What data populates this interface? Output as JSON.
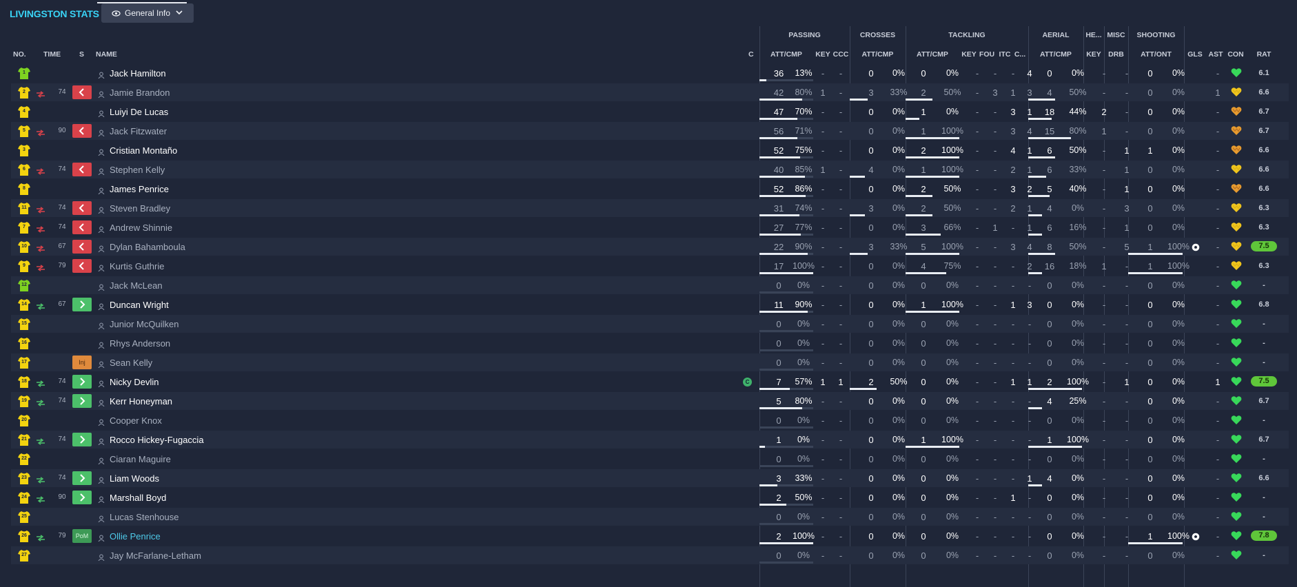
{
  "app": {
    "title": "LIVINGSTON STATS",
    "view_button_label": "General Info",
    "accent_color": "#39d3f5"
  },
  "columns": {
    "no": "NO.",
    "time": "TIME",
    "s": "S",
    "name": "NAME",
    "c": "C",
    "groups": {
      "passing": "PASSING",
      "crosses": "CROSSES",
      "tackling": "TACKLING",
      "aerial": "AERIAL",
      "headers": "HE...",
      "misc": "MISC",
      "shooting": "SHOOTING"
    },
    "sub": {
      "pass_att": "ATT/CMP",
      "pass_key": "KEY",
      "pass_ccc": "CCC",
      "cross_att": "ATT/CMP",
      "tack_att": "ATT/CMP",
      "tack_key": "KEY",
      "tack_fou": "FOU",
      "tack_itc": "ITC",
      "tack_c": "C...",
      "aer_att": "ATT/CMP",
      "head_key": "KEY",
      "misc_drb": "DRB",
      "shoot_att": "ATT/ONT",
      "gls": "GLS",
      "ast": "AST",
      "con": "CON",
      "rat": "RAT"
    }
  },
  "players": [
    {
      "no": "1",
      "time": "",
      "s": "",
      "name": "Jack Hamilton",
      "active": true,
      "pass": [
        "36",
        "13%"
      ],
      "pkey": "-",
      "pccc": "-",
      "cross": [
        "0",
        "0%"
      ],
      "tack": [
        "0",
        "0%"
      ],
      "tkey": "-",
      "tfou": "-",
      "titc": "-",
      "tc": "4",
      "aer": [
        "0",
        "0%"
      ],
      "hkey": "-",
      "drb": "-",
      "shoot": [
        "0",
        "0%"
      ],
      "gls": "",
      "ast": "-",
      "rat": "6.1",
      "ratHi": false
    },
    {
      "no": "2",
      "time": "74",
      "s": "out",
      "name": "Jamie Brandon",
      "active": false,
      "pass": [
        "42",
        "80%"
      ],
      "pkey": "1",
      "pccc": "-",
      "cross": [
        "3",
        "33%"
      ],
      "tack": [
        "2",
        "50%"
      ],
      "tkey": "-",
      "tfou": "3",
      "titc": "1",
      "tc": "3",
      "aer": [
        "4",
        "50%"
      ],
      "hkey": "-",
      "drb": "-",
      "shoot": [
        "0",
        "0%"
      ],
      "gls": "",
      "ast": "1",
      "rat": "6.6",
      "ratHi": false
    },
    {
      "no": "4",
      "time": "",
      "s": "",
      "name": "Luiyi De Lucas",
      "active": true,
      "pass": [
        "47",
        "70%"
      ],
      "pkey": "-",
      "pccc": "-",
      "cross": [
        "0",
        "0%"
      ],
      "tack": [
        "1",
        "0%"
      ],
      "tkey": "-",
      "tfou": "-",
      "titc": "3",
      "tc": "1",
      "aer": [
        "18",
        "44%"
      ],
      "hkey": "2",
      "drb": "-",
      "shoot": [
        "0",
        "0%"
      ],
      "gls": "",
      "ast": "-",
      "rat": "6.7",
      "ratHi": false
    },
    {
      "no": "5",
      "time": "90",
      "s": "out",
      "name": "Jack Fitzwater",
      "active": false,
      "pass": [
        "56",
        "71%"
      ],
      "pkey": "-",
      "pccc": "-",
      "cross": [
        "0",
        "0%"
      ],
      "tack": [
        "1",
        "100%"
      ],
      "tkey": "-",
      "tfou": "-",
      "titc": "3",
      "tc": "4",
      "aer": [
        "15",
        "80%"
      ],
      "hkey": "1",
      "drb": "-",
      "shoot": [
        "0",
        "0%"
      ],
      "gls": "",
      "ast": "-",
      "rat": "6.7",
      "ratHi": false
    },
    {
      "no": "3",
      "time": "",
      "s": "",
      "name": "Cristian Montaño",
      "active": true,
      "pass": [
        "52",
        "75%"
      ],
      "pkey": "-",
      "pccc": "-",
      "cross": [
        "0",
        "0%"
      ],
      "tack": [
        "2",
        "100%"
      ],
      "tkey": "-",
      "tfou": "-",
      "titc": "4",
      "tc": "1",
      "aer": [
        "6",
        "50%"
      ],
      "hkey": "-",
      "drb": "1",
      "shoot": [
        "1",
        "0%"
      ],
      "gls": "",
      "ast": "-",
      "rat": "6.6",
      "ratHi": false
    },
    {
      "no": "6",
      "time": "74",
      "s": "out",
      "name": "Stephen Kelly",
      "active": false,
      "pass": [
        "40",
        "85%"
      ],
      "pkey": "1",
      "pccc": "-",
      "cross": [
        "4",
        "0%"
      ],
      "tack": [
        "1",
        "100%"
      ],
      "tkey": "-",
      "tfou": "-",
      "titc": "2",
      "tc": "1",
      "aer": [
        "6",
        "33%"
      ],
      "hkey": "-",
      "drb": "1",
      "shoot": [
        "0",
        "0%"
      ],
      "gls": "",
      "ast": "-",
      "rat": "6.6",
      "ratHi": false
    },
    {
      "no": "8",
      "time": "",
      "s": "",
      "name": "James Penrice",
      "active": true,
      "pass": [
        "52",
        "86%"
      ],
      "pkey": "-",
      "pccc": "-",
      "cross": [
        "0",
        "0%"
      ],
      "tack": [
        "2",
        "50%"
      ],
      "tkey": "-",
      "tfou": "-",
      "titc": "3",
      "tc": "2",
      "aer": [
        "5",
        "40%"
      ],
      "hkey": "-",
      "drb": "1",
      "shoot": [
        "0",
        "0%"
      ],
      "gls": "",
      "ast": "-",
      "rat": "6.6",
      "ratHi": false
    },
    {
      "no": "11",
      "time": "74",
      "s": "out",
      "name": "Steven Bradley",
      "active": false,
      "pass": [
        "31",
        "74%"
      ],
      "pkey": "-",
      "pccc": "-",
      "cross": [
        "3",
        "0%"
      ],
      "tack": [
        "2",
        "50%"
      ],
      "tkey": "-",
      "tfou": "-",
      "titc": "2",
      "tc": "1",
      "aer": [
        "4",
        "0%"
      ],
      "hkey": "-",
      "drb": "3",
      "shoot": [
        "0",
        "0%"
      ],
      "gls": "",
      "ast": "-",
      "rat": "6.3",
      "ratHi": false
    },
    {
      "no": "7",
      "time": "74",
      "s": "out",
      "name": "Andrew Shinnie",
      "active": false,
      "pass": [
        "27",
        "77%"
      ],
      "pkey": "-",
      "pccc": "-",
      "cross": [
        "0",
        "0%"
      ],
      "tack": [
        "3",
        "66%"
      ],
      "tkey": "-",
      "tfou": "1",
      "titc": "-",
      "tc": "1",
      "aer": [
        "6",
        "16%"
      ],
      "hkey": "-",
      "drb": "1",
      "shoot": [
        "0",
        "0%"
      ],
      "gls": "",
      "ast": "-",
      "rat": "6.3",
      "ratHi": false
    },
    {
      "no": "10",
      "time": "67",
      "s": "out",
      "name": "Dylan Bahamboula",
      "active": false,
      "pass": [
        "22",
        "90%"
      ],
      "pkey": "-",
      "pccc": "-",
      "cross": [
        "3",
        "33%"
      ],
      "tack": [
        "5",
        "100%"
      ],
      "tkey": "-",
      "tfou": "-",
      "titc": "3",
      "tc": "4",
      "aer": [
        "8",
        "50%"
      ],
      "hkey": "-",
      "drb": "5",
      "shoot": [
        "1",
        "100%"
      ],
      "gls": "ball",
      "ast": "-",
      "rat": "7.5",
      "ratHi": true
    },
    {
      "no": "9",
      "time": "79",
      "s": "out",
      "name": "Kurtis Guthrie",
      "active": false,
      "pass": [
        "17",
        "100%"
      ],
      "pkey": "-",
      "pccc": "-",
      "cross": [
        "0",
        "0%"
      ],
      "tack": [
        "4",
        "75%"
      ],
      "tkey": "-",
      "tfou": "-",
      "titc": "-",
      "tc": "2",
      "aer": [
        "16",
        "18%"
      ],
      "hkey": "1",
      "drb": "-",
      "shoot": [
        "1",
        "100%"
      ],
      "gls": "",
      "ast": "-",
      "rat": "6.3",
      "ratHi": false
    },
    {
      "no": "12",
      "time": "",
      "s": "",
      "name": "Jack McLean",
      "active": false,
      "gk": true,
      "pass": [
        "0",
        "0%"
      ],
      "pkey": "-",
      "pccc": "-",
      "cross": [
        "0",
        "0%"
      ],
      "tack": [
        "0",
        "0%"
      ],
      "tkey": "-",
      "tfou": "-",
      "titc": "-",
      "tc": "-",
      "aer": [
        "0",
        "0%"
      ],
      "hkey": "-",
      "drb": "-",
      "shoot": [
        "0",
        "0%"
      ],
      "gls": "",
      "ast": "-",
      "rat": "-",
      "ratHi": false
    },
    {
      "no": "14",
      "time": "67",
      "s": "in",
      "name": "Duncan Wright",
      "active": true,
      "pass": [
        "11",
        "90%"
      ],
      "pkey": "-",
      "pccc": "-",
      "cross": [
        "0",
        "0%"
      ],
      "tack": [
        "1",
        "100%"
      ],
      "tkey": "-",
      "tfou": "-",
      "titc": "1",
      "tc": "3",
      "aer": [
        "0",
        "0%"
      ],
      "hkey": "-",
      "drb": "-",
      "shoot": [
        "0",
        "0%"
      ],
      "gls": "",
      "ast": "-",
      "rat": "6.8",
      "ratHi": false
    },
    {
      "no": "15",
      "time": "",
      "s": "",
      "name": "Junior McQuilken",
      "active": false,
      "pass": [
        "0",
        "0%"
      ],
      "pkey": "-",
      "pccc": "-",
      "cross": [
        "0",
        "0%"
      ],
      "tack": [
        "0",
        "0%"
      ],
      "tkey": "-",
      "tfou": "-",
      "titc": "-",
      "tc": "-",
      "aer": [
        "0",
        "0%"
      ],
      "hkey": "-",
      "drb": "-",
      "shoot": [
        "0",
        "0%"
      ],
      "gls": "",
      "ast": "-",
      "rat": "-",
      "ratHi": false
    },
    {
      "no": "16",
      "time": "",
      "s": "",
      "name": "Rhys Anderson",
      "active": false,
      "pass": [
        "0",
        "0%"
      ],
      "pkey": "-",
      "pccc": "-",
      "cross": [
        "0",
        "0%"
      ],
      "tack": [
        "0",
        "0%"
      ],
      "tkey": "-",
      "tfou": "-",
      "titc": "-",
      "tc": "-",
      "aer": [
        "0",
        "0%"
      ],
      "hkey": "-",
      "drb": "-",
      "shoot": [
        "0",
        "0%"
      ],
      "gls": "",
      "ast": "-",
      "rat": "-",
      "ratHi": false
    },
    {
      "no": "17",
      "time": "",
      "s": "inj",
      "name": "Sean Kelly",
      "active": false,
      "pass": [
        "0",
        "0%"
      ],
      "pkey": "-",
      "pccc": "-",
      "cross": [
        "0",
        "0%"
      ],
      "tack": [
        "0",
        "0%"
      ],
      "tkey": "-",
      "tfou": "-",
      "titc": "-",
      "tc": "-",
      "aer": [
        "0",
        "0%"
      ],
      "hkey": "-",
      "drb": "-",
      "shoot": [
        "0",
        "0%"
      ],
      "gls": "",
      "ast": "-",
      "rat": "-",
      "ratHi": false
    },
    {
      "no": "18",
      "time": "74",
      "s": "in",
      "name": "Nicky Devlin",
      "active": true,
      "captain": true,
      "pass": [
        "7",
        "57%"
      ],
      "pkey": "1",
      "pccc": "1",
      "cross": [
        "2",
        "50%"
      ],
      "tack": [
        "0",
        "0%"
      ],
      "tkey": "-",
      "tfou": "-",
      "titc": "1",
      "tc": "1",
      "aer": [
        "2",
        "100%"
      ],
      "hkey": "-",
      "drb": "1",
      "shoot": [
        "0",
        "0%"
      ],
      "gls": "",
      "ast": "1",
      "rat": "7.5",
      "ratHi": true
    },
    {
      "no": "19",
      "time": "74",
      "s": "in",
      "name": "Kerr Honeyman",
      "active": true,
      "pass": [
        "5",
        "80%"
      ],
      "pkey": "-",
      "pccc": "-",
      "cross": [
        "0",
        "0%"
      ],
      "tack": [
        "0",
        "0%"
      ],
      "tkey": "-",
      "tfou": "-",
      "titc": "-",
      "tc": "-",
      "aer": [
        "4",
        "25%"
      ],
      "hkey": "-",
      "drb": "-",
      "shoot": [
        "0",
        "0%"
      ],
      "gls": "",
      "ast": "-",
      "rat": "6.7",
      "ratHi": false
    },
    {
      "no": "20",
      "time": "",
      "s": "",
      "name": "Cooper Knox",
      "active": false,
      "pass": [
        "0",
        "0%"
      ],
      "pkey": "-",
      "pccc": "-",
      "cross": [
        "0",
        "0%"
      ],
      "tack": [
        "0",
        "0%"
      ],
      "tkey": "-",
      "tfou": "-",
      "titc": "-",
      "tc": "-",
      "aer": [
        "0",
        "0%"
      ],
      "hkey": "-",
      "drb": "-",
      "shoot": [
        "0",
        "0%"
      ],
      "gls": "",
      "ast": "-",
      "rat": "-",
      "ratHi": false
    },
    {
      "no": "21",
      "time": "74",
      "s": "in",
      "name": "Rocco Hickey-Fugaccia",
      "active": true,
      "pass": [
        "1",
        "0%"
      ],
      "pkey": "-",
      "pccc": "-",
      "cross": [
        "0",
        "0%"
      ],
      "tack": [
        "1",
        "100%"
      ],
      "tkey": "-",
      "tfou": "-",
      "titc": "-",
      "tc": "-",
      "aer": [
        "1",
        "100%"
      ],
      "hkey": "-",
      "drb": "-",
      "shoot": [
        "0",
        "0%"
      ],
      "gls": "",
      "ast": "-",
      "rat": "6.7",
      "ratHi": false
    },
    {
      "no": "22",
      "time": "",
      "s": "",
      "name": "Ciaran Maguire",
      "active": false,
      "pass": [
        "0",
        "0%"
      ],
      "pkey": "-",
      "pccc": "-",
      "cross": [
        "0",
        "0%"
      ],
      "tack": [
        "0",
        "0%"
      ],
      "tkey": "-",
      "tfou": "-",
      "titc": "-",
      "tc": "-",
      "aer": [
        "0",
        "0%"
      ],
      "hkey": "-",
      "drb": "-",
      "shoot": [
        "0",
        "0%"
      ],
      "gls": "",
      "ast": "-",
      "rat": "-",
      "ratHi": false
    },
    {
      "no": "23",
      "time": "74",
      "s": "in",
      "name": "Liam Woods",
      "active": true,
      "pass": [
        "3",
        "33%"
      ],
      "pkey": "-",
      "pccc": "-",
      "cross": [
        "0",
        "0%"
      ],
      "tack": [
        "0",
        "0%"
      ],
      "tkey": "-",
      "tfou": "-",
      "titc": "-",
      "tc": "1",
      "aer": [
        "4",
        "0%"
      ],
      "hkey": "-",
      "drb": "-",
      "shoot": [
        "0",
        "0%"
      ],
      "gls": "",
      "ast": "-",
      "rat": "6.6",
      "ratHi": false
    },
    {
      "no": "24",
      "time": "90",
      "s": "in",
      "name": "Marshall Boyd",
      "active": true,
      "pass": [
        "2",
        "50%"
      ],
      "pkey": "-",
      "pccc": "-",
      "cross": [
        "0",
        "0%"
      ],
      "tack": [
        "0",
        "0%"
      ],
      "tkey": "-",
      "tfou": "-",
      "titc": "1",
      "tc": "-",
      "aer": [
        "0",
        "0%"
      ],
      "hkey": "-",
      "drb": "-",
      "shoot": [
        "0",
        "0%"
      ],
      "gls": "",
      "ast": "-",
      "rat": "-",
      "ratHi": false
    },
    {
      "no": "25",
      "time": "",
      "s": "",
      "name": "Lucas Stenhouse",
      "active": false,
      "pass": [
        "0",
        "0%"
      ],
      "pkey": "-",
      "pccc": "-",
      "cross": [
        "0",
        "0%"
      ],
      "tack": [
        "0",
        "0%"
      ],
      "tkey": "-",
      "tfou": "-",
      "titc": "-",
      "tc": "-",
      "aer": [
        "0",
        "0%"
      ],
      "hkey": "-",
      "drb": "-",
      "shoot": [
        "0",
        "0%"
      ],
      "gls": "",
      "ast": "-",
      "rat": "-",
      "ratHi": false
    },
    {
      "no": "26",
      "time": "79",
      "s": "pom",
      "name": "Ollie Penrice",
      "active": true,
      "pom": true,
      "pass": [
        "2",
        "100%"
      ],
      "pkey": "-",
      "pccc": "-",
      "cross": [
        "0",
        "0%"
      ],
      "tack": [
        "0",
        "0%"
      ],
      "tkey": "-",
      "tfou": "-",
      "titc": "-",
      "tc": "-",
      "aer": [
        "0",
        "0%"
      ],
      "hkey": "-",
      "drb": "-",
      "shoot": [
        "1",
        "100%"
      ],
      "gls": "ball",
      "ast": "-",
      "rat": "7.8",
      "ratHi": true
    },
    {
      "no": "27",
      "time": "",
      "s": "",
      "name": "Jay McFarlane-Letham",
      "active": false,
      "pass": [
        "0",
        "0%"
      ],
      "pkey": "-",
      "pccc": "-",
      "cross": [
        "0",
        "0%"
      ],
      "tack": [
        "0",
        "0%"
      ],
      "tkey": "-",
      "tfou": "-",
      "titc": "-",
      "tc": "-",
      "aer": [
        "0",
        "0%"
      ],
      "hkey": "-",
      "drb": "-",
      "shoot": [
        "0",
        "0%"
      ],
      "gls": "",
      "ast": "-",
      "rat": "-",
      "ratHi": false
    }
  ],
  "badges": {
    "inj": "Inj",
    "pom": "PoM",
    "captain": "C"
  },
  "colors": {
    "shirt": "#f3d30f",
    "gk_shirt": "#7ed321",
    "heart": "#38d85a",
    "rating_high": "#5fc63a",
    "sub_out": "#d9424a",
    "sub_in": "#4cc06a"
  },
  "icons": {
    "shirt": "shirt-icon",
    "sub": "substitution-arrows-icon",
    "person": "person-icon",
    "heart": "condition-heart-icon",
    "ball": "football-icon",
    "eye": "eye-icon"
  }
}
